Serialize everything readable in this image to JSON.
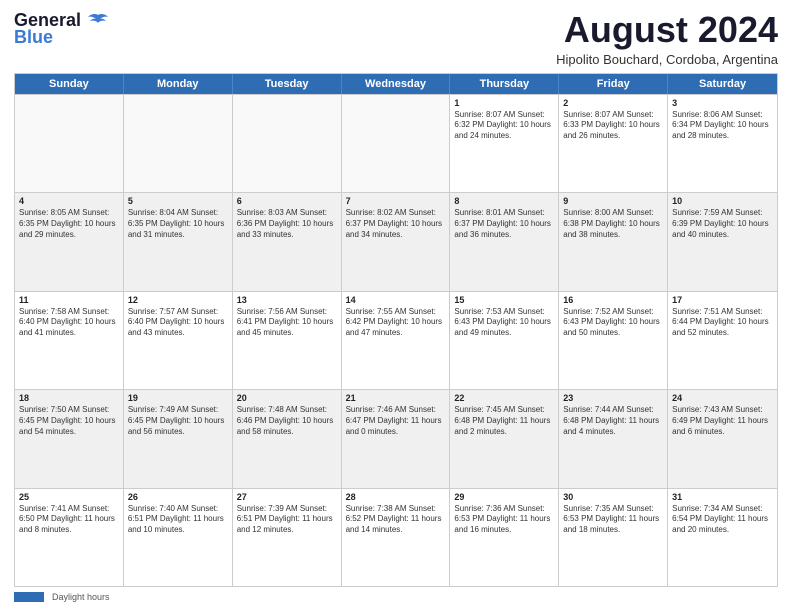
{
  "header": {
    "logo_line1": "General",
    "logo_line2": "Blue",
    "month_year": "August 2024",
    "location": "Hipolito Bouchard, Cordoba, Argentina"
  },
  "days_of_week": [
    "Sunday",
    "Monday",
    "Tuesday",
    "Wednesday",
    "Thursday",
    "Friday",
    "Saturday"
  ],
  "weeks": [
    [
      {
        "day": "",
        "info": ""
      },
      {
        "day": "",
        "info": ""
      },
      {
        "day": "",
        "info": ""
      },
      {
        "day": "",
        "info": ""
      },
      {
        "day": "1",
        "info": "Sunrise: 8:07 AM\nSunset: 6:32 PM\nDaylight: 10 hours\nand 24 minutes."
      },
      {
        "day": "2",
        "info": "Sunrise: 8:07 AM\nSunset: 6:33 PM\nDaylight: 10 hours\nand 26 minutes."
      },
      {
        "day": "3",
        "info": "Sunrise: 8:06 AM\nSunset: 6:34 PM\nDaylight: 10 hours\nand 28 minutes."
      }
    ],
    [
      {
        "day": "4",
        "info": "Sunrise: 8:05 AM\nSunset: 6:35 PM\nDaylight: 10 hours\nand 29 minutes."
      },
      {
        "day": "5",
        "info": "Sunrise: 8:04 AM\nSunset: 6:35 PM\nDaylight: 10 hours\nand 31 minutes."
      },
      {
        "day": "6",
        "info": "Sunrise: 8:03 AM\nSunset: 6:36 PM\nDaylight: 10 hours\nand 33 minutes."
      },
      {
        "day": "7",
        "info": "Sunrise: 8:02 AM\nSunset: 6:37 PM\nDaylight: 10 hours\nand 34 minutes."
      },
      {
        "day": "8",
        "info": "Sunrise: 8:01 AM\nSunset: 6:37 PM\nDaylight: 10 hours\nand 36 minutes."
      },
      {
        "day": "9",
        "info": "Sunrise: 8:00 AM\nSunset: 6:38 PM\nDaylight: 10 hours\nand 38 minutes."
      },
      {
        "day": "10",
        "info": "Sunrise: 7:59 AM\nSunset: 6:39 PM\nDaylight: 10 hours\nand 40 minutes."
      }
    ],
    [
      {
        "day": "11",
        "info": "Sunrise: 7:58 AM\nSunset: 6:40 PM\nDaylight: 10 hours\nand 41 minutes."
      },
      {
        "day": "12",
        "info": "Sunrise: 7:57 AM\nSunset: 6:40 PM\nDaylight: 10 hours\nand 43 minutes."
      },
      {
        "day": "13",
        "info": "Sunrise: 7:56 AM\nSunset: 6:41 PM\nDaylight: 10 hours\nand 45 minutes."
      },
      {
        "day": "14",
        "info": "Sunrise: 7:55 AM\nSunset: 6:42 PM\nDaylight: 10 hours\nand 47 minutes."
      },
      {
        "day": "15",
        "info": "Sunrise: 7:53 AM\nSunset: 6:43 PM\nDaylight: 10 hours\nand 49 minutes."
      },
      {
        "day": "16",
        "info": "Sunrise: 7:52 AM\nSunset: 6:43 PM\nDaylight: 10 hours\nand 50 minutes."
      },
      {
        "day": "17",
        "info": "Sunrise: 7:51 AM\nSunset: 6:44 PM\nDaylight: 10 hours\nand 52 minutes."
      }
    ],
    [
      {
        "day": "18",
        "info": "Sunrise: 7:50 AM\nSunset: 6:45 PM\nDaylight: 10 hours\nand 54 minutes."
      },
      {
        "day": "19",
        "info": "Sunrise: 7:49 AM\nSunset: 6:45 PM\nDaylight: 10 hours\nand 56 minutes."
      },
      {
        "day": "20",
        "info": "Sunrise: 7:48 AM\nSunset: 6:46 PM\nDaylight: 10 hours\nand 58 minutes."
      },
      {
        "day": "21",
        "info": "Sunrise: 7:46 AM\nSunset: 6:47 PM\nDaylight: 11 hours\nand 0 minutes."
      },
      {
        "day": "22",
        "info": "Sunrise: 7:45 AM\nSunset: 6:48 PM\nDaylight: 11 hours\nand 2 minutes."
      },
      {
        "day": "23",
        "info": "Sunrise: 7:44 AM\nSunset: 6:48 PM\nDaylight: 11 hours\nand 4 minutes."
      },
      {
        "day": "24",
        "info": "Sunrise: 7:43 AM\nSunset: 6:49 PM\nDaylight: 11 hours\nand 6 minutes."
      }
    ],
    [
      {
        "day": "25",
        "info": "Sunrise: 7:41 AM\nSunset: 6:50 PM\nDaylight: 11 hours\nand 8 minutes."
      },
      {
        "day": "26",
        "info": "Sunrise: 7:40 AM\nSunset: 6:51 PM\nDaylight: 11 hours\nand 10 minutes."
      },
      {
        "day": "27",
        "info": "Sunrise: 7:39 AM\nSunset: 6:51 PM\nDaylight: 11 hours\nand 12 minutes."
      },
      {
        "day": "28",
        "info": "Sunrise: 7:38 AM\nSunset: 6:52 PM\nDaylight: 11 hours\nand 14 minutes."
      },
      {
        "day": "29",
        "info": "Sunrise: 7:36 AM\nSunset: 6:53 PM\nDaylight: 11 hours\nand 16 minutes."
      },
      {
        "day": "30",
        "info": "Sunrise: 7:35 AM\nSunset: 6:53 PM\nDaylight: 11 hours\nand 18 minutes."
      },
      {
        "day": "31",
        "info": "Sunrise: 7:34 AM\nSunset: 6:54 PM\nDaylight: 11 hours\nand 20 minutes."
      }
    ]
  ],
  "footer": {
    "legend_label": "Daylight hours"
  }
}
